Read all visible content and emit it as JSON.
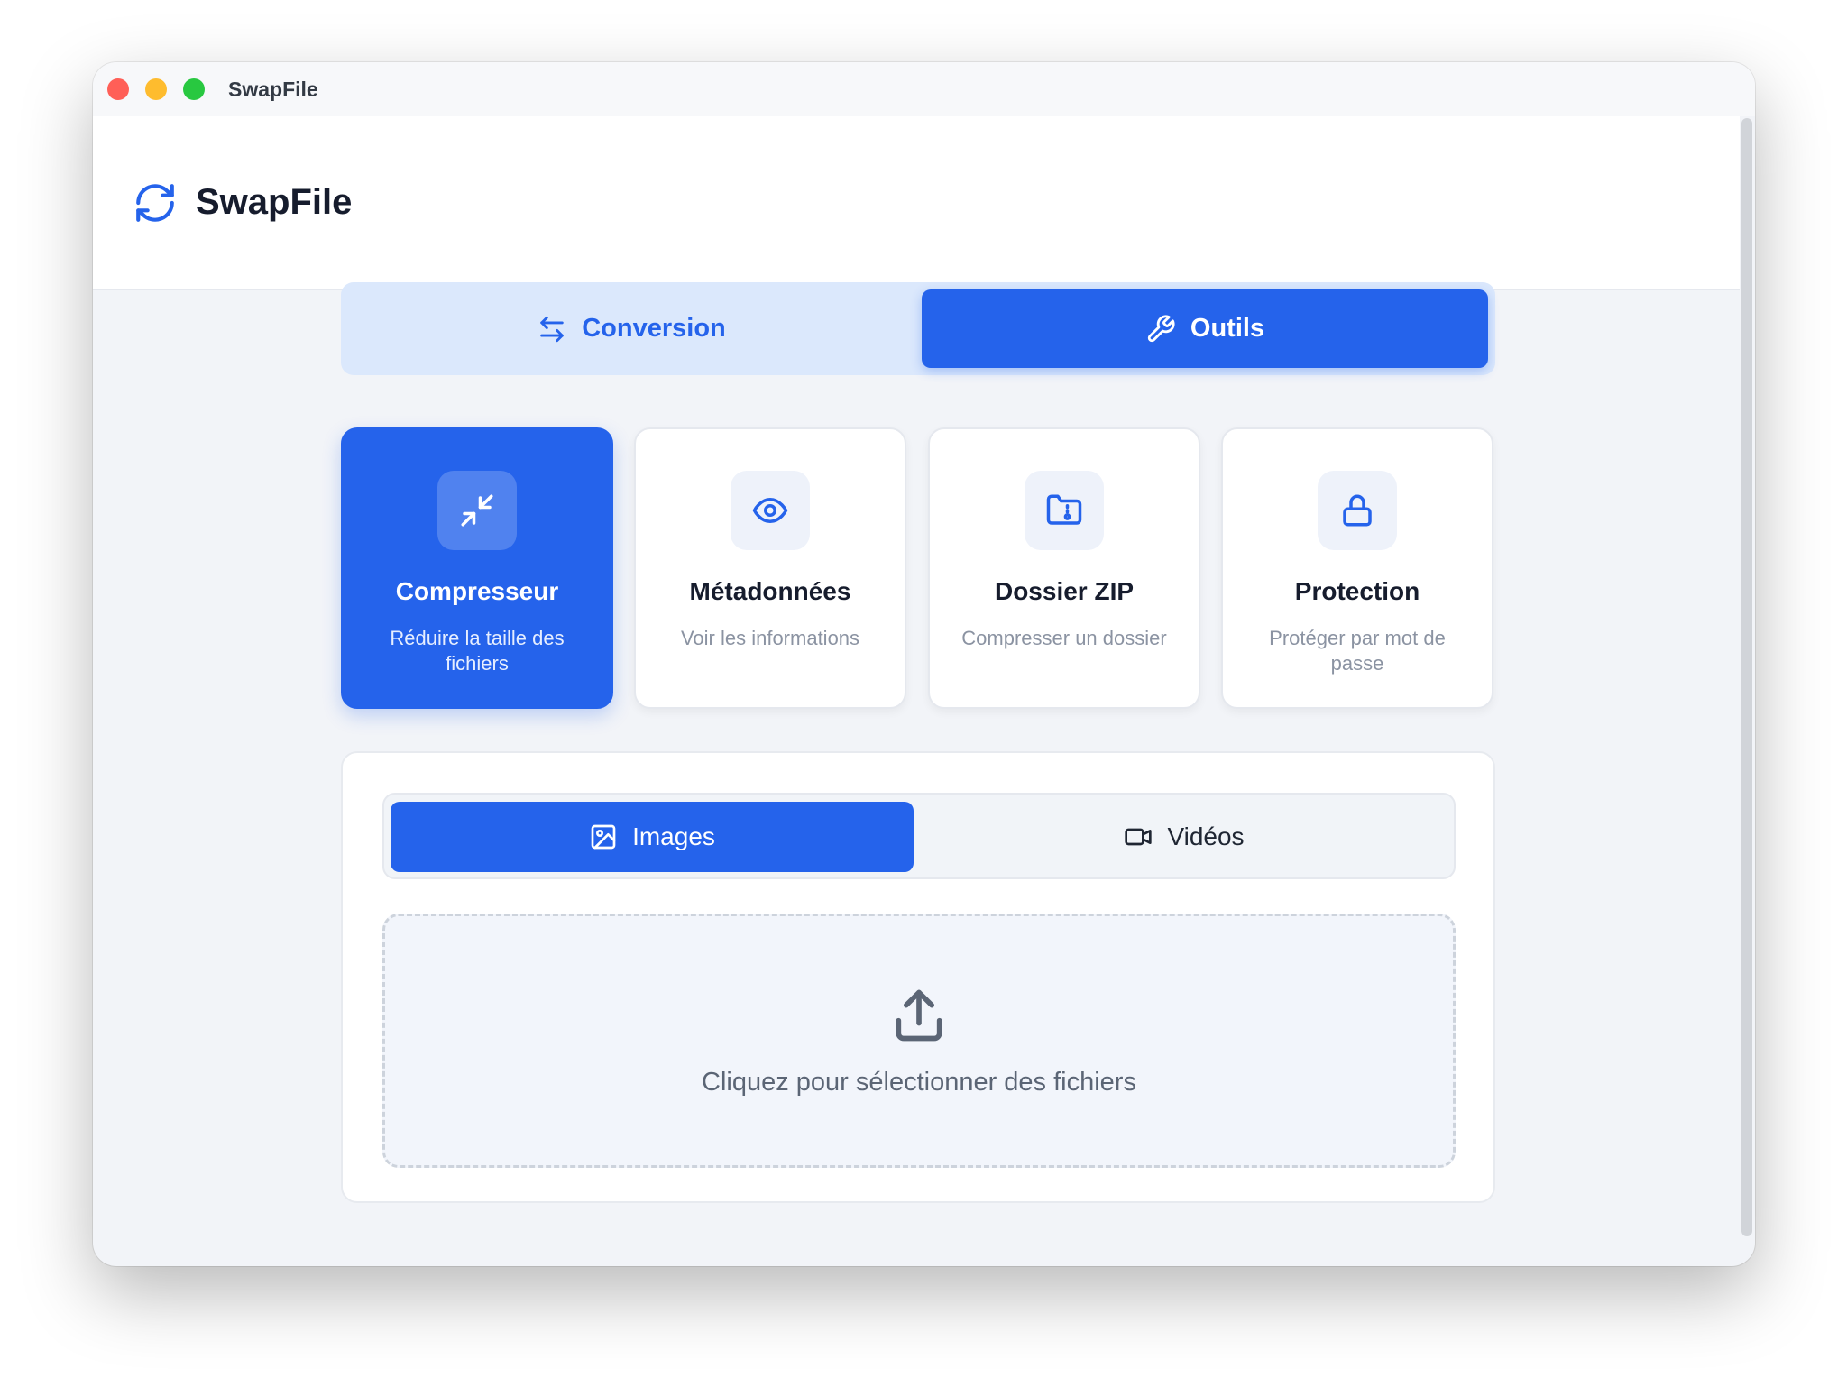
{
  "window": {
    "title": "SwapFile"
  },
  "header": {
    "app_name": "SwapFile",
    "logo_icon": "refresh-icon"
  },
  "mode_tabs": {
    "items": [
      {
        "label": "Conversion",
        "icon": "arrows-exchange-icon",
        "active": false
      },
      {
        "label": "Outils",
        "icon": "wrench-icon",
        "active": true
      }
    ]
  },
  "tools": {
    "items": [
      {
        "title": "Compresseur",
        "description": "Réduire la taille des fichiers",
        "icon": "compress-arrows-icon",
        "active": true
      },
      {
        "title": "Métadonnées",
        "description": "Voir les informations",
        "icon": "eye-icon",
        "active": false
      },
      {
        "title": "Dossier ZIP",
        "description": "Compresser un dossier",
        "icon": "zip-folder-icon",
        "active": false
      },
      {
        "title": "Protection",
        "description": "Protéger par mot de passe",
        "icon": "lock-icon",
        "active": false
      }
    ]
  },
  "media_tabs": {
    "items": [
      {
        "label": "Images",
        "icon": "image-icon",
        "active": true
      },
      {
        "label": "Vidéos",
        "icon": "video-camera-icon",
        "active": false
      }
    ]
  },
  "dropzone": {
    "text": "Cliquez pour sélectionner des fichiers",
    "icon": "upload-icon"
  },
  "colors": {
    "accent": "#2563eb",
    "accent_soft": "#dbe8fc",
    "background": "#f2f4f8"
  }
}
